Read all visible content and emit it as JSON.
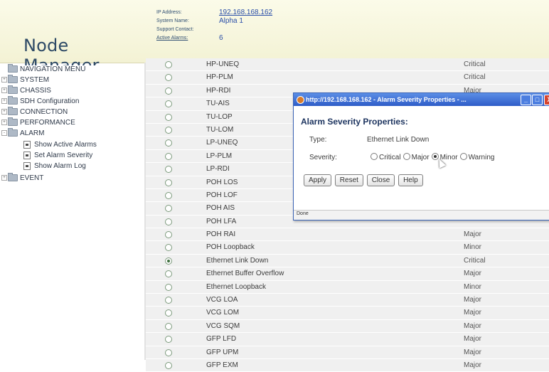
{
  "header": {
    "logo_text": "Node Manager",
    "info": [
      {
        "label": "IP Address:",
        "value": "192.168.168.162",
        "label_link": false,
        "value_link": true
      },
      {
        "label": "System Name:",
        "value": "Alpha 1",
        "label_link": false,
        "value_link": false
      },
      {
        "label": "Support Contact:",
        "value": "",
        "label_link": false,
        "value_link": false
      },
      {
        "label": "Active Alarms:",
        "value": "6",
        "label_link": true,
        "value_link": false
      }
    ]
  },
  "nav": {
    "items": [
      {
        "label": "NAVIGATION MENU",
        "indent": 0,
        "expander": "",
        "icon": "folder-icon"
      },
      {
        "label": "SYSTEM",
        "indent": 0,
        "expander": "+",
        "icon": "folder-icon"
      },
      {
        "label": "CHASSIS",
        "indent": 0,
        "expander": "+",
        "icon": "folder-icon"
      },
      {
        "label": "SDH Configuration",
        "indent": 0,
        "expander": "+",
        "icon": "folder-icon"
      },
      {
        "label": "CONNECTION",
        "indent": 0,
        "expander": "+",
        "icon": "folder-icon"
      },
      {
        "label": "PERFORMANCE",
        "indent": 0,
        "expander": "+",
        "icon": "folder-icon"
      },
      {
        "label": "ALARM",
        "indent": 0,
        "expander": "-",
        "icon": "folder-icon"
      },
      {
        "label": "Show Active Alarms",
        "indent": 1,
        "expander": "",
        "icon": "page-icon"
      },
      {
        "label": "Set Alarm Severity",
        "indent": 1,
        "expander": "",
        "icon": "page-icon"
      },
      {
        "label": "Show Alarm Log",
        "indent": 1,
        "expander": "",
        "icon": "page-icon"
      },
      {
        "label": "EVENT",
        "indent": 0,
        "expander": "+",
        "icon": "folder-icon"
      }
    ]
  },
  "alarms": {
    "rows": [
      {
        "name": "HP-UNEQ",
        "severity": "Critical",
        "selected": false
      },
      {
        "name": "HP-PLM",
        "severity": "Critical",
        "selected": false
      },
      {
        "name": "HP-RDI",
        "severity": "Major",
        "selected": false
      },
      {
        "name": "TU-AIS",
        "severity": "",
        "selected": false
      },
      {
        "name": "TU-LOP",
        "severity": "",
        "selected": false
      },
      {
        "name": "TU-LOM",
        "severity": "",
        "selected": false
      },
      {
        "name": "LP-UNEQ",
        "severity": "",
        "selected": false
      },
      {
        "name": "LP-PLM",
        "severity": "",
        "selected": false
      },
      {
        "name": "LP-RDI",
        "severity": "",
        "selected": false
      },
      {
        "name": "POH LOS",
        "severity": "",
        "selected": false
      },
      {
        "name": "POH LOF",
        "severity": "",
        "selected": false
      },
      {
        "name": "POH AIS",
        "severity": "",
        "selected": false
      },
      {
        "name": "POH LFA",
        "severity": "",
        "selected": false
      },
      {
        "name": "POH RAI",
        "severity": "Major",
        "selected": false
      },
      {
        "name": "POH Loopback",
        "severity": "Minor",
        "selected": false
      },
      {
        "name": "Ethernet Link Down",
        "severity": "Critical",
        "selected": true
      },
      {
        "name": "Ethernet Buffer Overflow",
        "severity": "Major",
        "selected": false
      },
      {
        "name": "Ethernet Loopback",
        "severity": "Minor",
        "selected": false
      },
      {
        "name": "VCG LOA",
        "severity": "Major",
        "selected": false
      },
      {
        "name": "VCG LOM",
        "severity": "Major",
        "selected": false
      },
      {
        "name": "VCG SQM",
        "severity": "Major",
        "selected": false
      },
      {
        "name": "GFP LFD",
        "severity": "Major",
        "selected": false
      },
      {
        "name": "GFP UPM",
        "severity": "Major",
        "selected": false
      },
      {
        "name": "GFP EXM",
        "severity": "Major",
        "selected": false
      }
    ]
  },
  "popup": {
    "title": "http://192.168.168.162 - Alarm Severity Properties - ...",
    "window_buttons": {
      "minimize": "_",
      "maximize": "□",
      "close": "X"
    },
    "heading": "Alarm Severity Properties:",
    "type_label": "Type:",
    "type_value": "Ethernet Link Down",
    "severity_label": "Severity:",
    "severity_options": [
      {
        "label": "Critical",
        "checked": false
      },
      {
        "label": "Major",
        "checked": false
      },
      {
        "label": "Minor",
        "checked": true
      },
      {
        "label": "Warning",
        "checked": false
      }
    ],
    "buttons": {
      "apply": "Apply",
      "reset": "Reset",
      "close": "Close",
      "help": "Help"
    },
    "status": "Done"
  },
  "colors": {
    "header_bg": "#f3f2d4",
    "titlebar": "#2e5cc8",
    "row_bg": "#f0f0f0",
    "link": "#2a4ea8"
  }
}
